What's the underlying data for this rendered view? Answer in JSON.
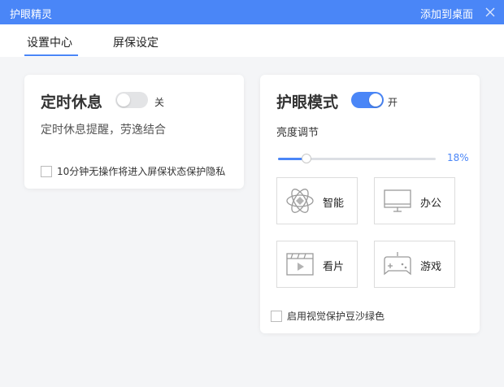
{
  "titlebar": {
    "title": "护眼精灵",
    "add_to_desktop": "添加到桌面"
  },
  "tabs": [
    {
      "label": "设置中心",
      "active": true
    },
    {
      "label": "屏保设定",
      "active": false
    }
  ],
  "rest_card": {
    "title": "定时休息",
    "toggle_state": "关",
    "description": "定时休息提醒，劳逸结合",
    "checkbox_label": "10分钟无操作将进入屏保状态保护隐私"
  },
  "eye_card": {
    "title": "护眼模式",
    "toggle_state": "开",
    "brightness_label": "亮度调节",
    "brightness_value": 18,
    "brightness_text": "18%",
    "modes": [
      {
        "label": "智能",
        "icon": "atom-icon"
      },
      {
        "label": "办公",
        "icon": "monitor-icon"
      },
      {
        "label": "看片",
        "icon": "film-icon"
      },
      {
        "label": "游戏",
        "icon": "gamepad-icon"
      }
    ],
    "checkbox_label": "启用视觉保护豆沙绿色"
  },
  "colors": {
    "accent": "#4a86f7",
    "toggle_off": "#e3e4e6"
  }
}
